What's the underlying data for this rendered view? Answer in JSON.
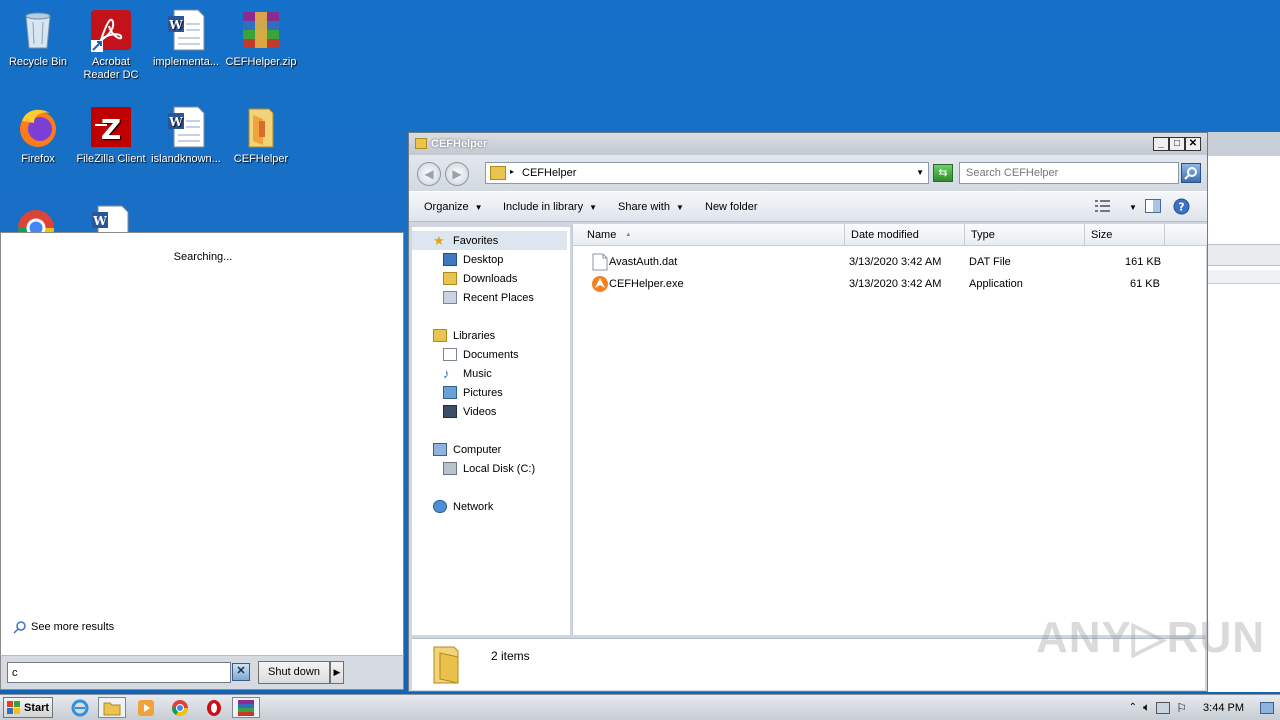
{
  "desktop": {
    "icons": [
      {
        "label": "Recycle Bin"
      },
      {
        "label": "Acrobat\nReader DC"
      },
      {
        "label": "implementa..."
      },
      {
        "label": "CEFHelper.zip"
      },
      {
        "label": "Firefox"
      },
      {
        "label": "FileZilla Client"
      },
      {
        "label": "islandknown..."
      },
      {
        "label": "CEFHelper"
      }
    ]
  },
  "start_menu": {
    "status": "Searching...",
    "see_more": "See more results",
    "search_value": "c",
    "clear_label": "✕",
    "shutdown_label": "Shut down",
    "shutdown_arrow": "▶"
  },
  "explorer": {
    "title": "CEFHelper",
    "window_buttons": {
      "minimize": "_",
      "maximize": "□",
      "close": "✕"
    },
    "address": {
      "path": "CEFHelper",
      "separator": "▸",
      "dropdown": "▼"
    },
    "search": {
      "placeholder": "Search CEFHelper"
    },
    "toolbar": {
      "organize": "Organize",
      "include": "Include in library",
      "share": "Share with",
      "new_folder": "New folder",
      "arrow": "▼"
    },
    "nav": {
      "favorites": "Favorites",
      "desktop": "Desktop",
      "downloads": "Downloads",
      "recent": "Recent Places",
      "libraries": "Libraries",
      "documents": "Documents",
      "music": "Music",
      "pictures": "Pictures",
      "videos": "Videos",
      "computer": "Computer",
      "local_disk": "Local Disk (C:)",
      "network": "Network"
    },
    "columns": {
      "name": "Name",
      "date": "Date modified",
      "type": "Type",
      "size": "Size",
      "sort_arrow": "▲"
    },
    "files": [
      {
        "name": "AvastAuth.dat",
        "date": "3/13/2020 3:42 AM",
        "type": "DAT File",
        "size": "161 KB"
      },
      {
        "name": "CEFHelper.exe",
        "date": "3/13/2020 3:42 AM",
        "type": "Application",
        "size": "61 KB"
      }
    ],
    "details": {
      "count": "2 items"
    }
  },
  "taskbar": {
    "start_label": "Start",
    "clock": "3:44 PM"
  },
  "watermark": "ANY▷RUN",
  "colors": {
    "desktop": "#1470c8",
    "taskbar": "#d4d9df",
    "folder": "#e9c451"
  }
}
